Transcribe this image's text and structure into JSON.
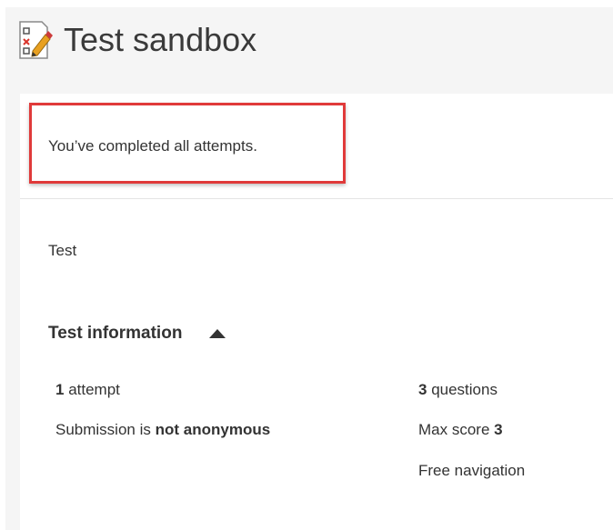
{
  "header": {
    "title": "Test sandbox",
    "icon": "quiz-icon"
  },
  "status": {
    "message": "You’ve completed all attempts.",
    "highlight_color": "#e03a3a"
  },
  "description": "Test",
  "test_info": {
    "heading": "Test information",
    "toggle_icon": "collapse-up-icon",
    "left_column": [
      {
        "strong": "1",
        "rest": " attempt"
      },
      {
        "prefix": "Submission is ",
        "strong": "not anonymous"
      }
    ],
    "right_column": [
      {
        "strong": "3",
        "rest": " questions"
      },
      {
        "prefix": "Max score ",
        "strong": "3"
      },
      {
        "text": "Free navigation"
      }
    ]
  }
}
